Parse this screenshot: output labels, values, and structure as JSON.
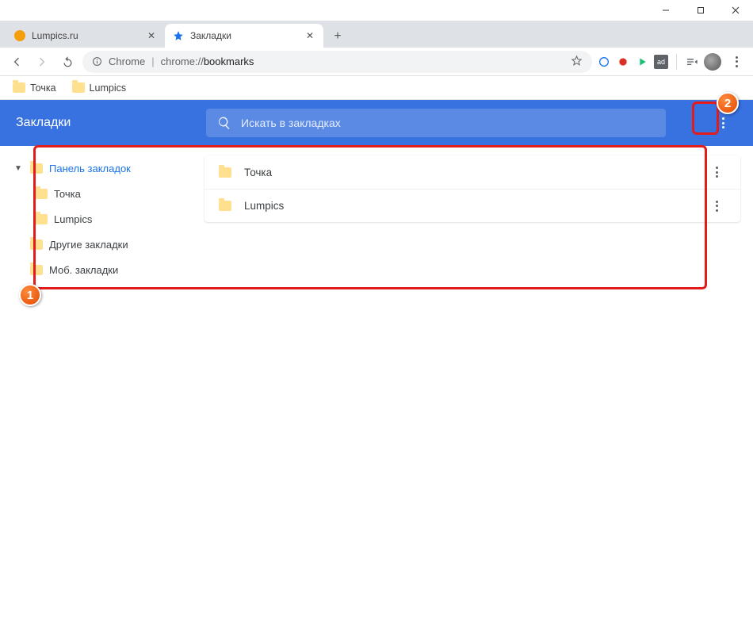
{
  "window_controls": {
    "minimize": "–",
    "maximize": "□",
    "close": "✕"
  },
  "tabs": [
    {
      "title": "Lumpics.ru",
      "active": false,
      "favicon_color": "#f59e0b"
    },
    {
      "title": "Закладки",
      "active": true,
      "favicon_is_star": true
    }
  ],
  "toolbar": {
    "url_secure_label": "Chrome",
    "url_prefix": "chrome://",
    "url_path": "bookmarks"
  },
  "bookmarks_bar": [
    {
      "label": "Точка"
    },
    {
      "label": "Lumpics"
    }
  ],
  "header": {
    "title": "Закладки",
    "search_placeholder": "Искать в закладках"
  },
  "sidebar": {
    "items": [
      {
        "label": "Панель закладок",
        "depth": 0,
        "expanded": true,
        "selected": true
      },
      {
        "label": "Точка",
        "depth": 1
      },
      {
        "label": "Lumpics",
        "depth": 1
      },
      {
        "label": "Другие закладки",
        "depth": 0
      },
      {
        "label": "Моб. закладки",
        "depth": 0
      }
    ]
  },
  "list": [
    {
      "label": "Точка"
    },
    {
      "label": "Lumpics"
    }
  ],
  "annotations": {
    "badge1": "1",
    "badge2": "2"
  },
  "colors": {
    "header_bg": "#3871e0",
    "highlight": "#e21b1b",
    "folder": "#ffe08f"
  }
}
